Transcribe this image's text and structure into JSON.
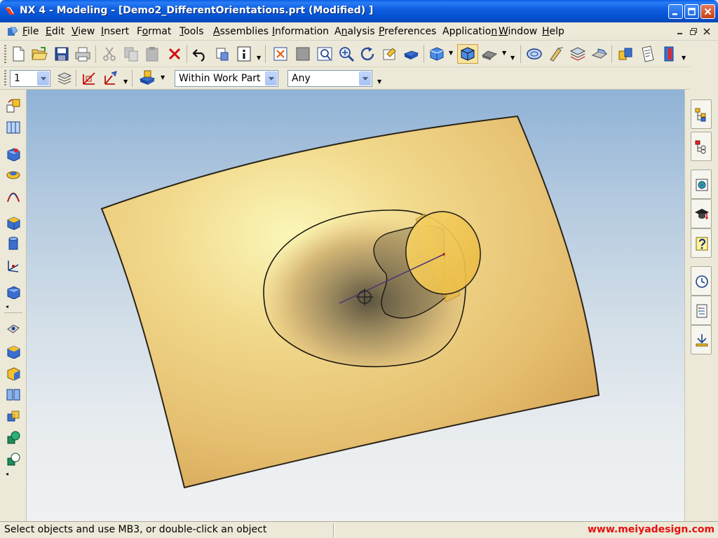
{
  "window": {
    "title": "NX 4 - Modeling - [Demo2_DifferentOrientations.prt (Modified) ]"
  },
  "menu": {
    "items": [
      {
        "pre": "",
        "mn": "F",
        "post": "ile"
      },
      {
        "pre": "",
        "mn": "E",
        "post": "dit"
      },
      {
        "pre": "",
        "mn": "V",
        "post": "iew"
      },
      {
        "pre": "",
        "mn": "I",
        "post": "nsert"
      },
      {
        "pre": "F",
        "mn": "o",
        "post": "rmat"
      },
      {
        "pre": "",
        "mn": "T",
        "post": "ools"
      },
      {
        "pre": "",
        "mn": "A",
        "post": "ssemblies"
      },
      {
        "pre": "",
        "mn": "I",
        "post": "nformation"
      },
      {
        "pre": "A",
        "mn": "n",
        "post": "alysis"
      },
      {
        "pre": "",
        "mn": "P",
        "post": "references"
      },
      {
        "pre": "Applicatio",
        "mn": "n",
        "post": ""
      },
      {
        "pre": "",
        "mn": "W",
        "post": "indow"
      },
      {
        "pre": "",
        "mn": "H",
        "post": "elp"
      }
    ]
  },
  "toolbar2": {
    "layer_value": "1",
    "filter_scope": "Within Work Part",
    "type_filter": "Any"
  },
  "status": {
    "prompt": "Select objects and use MB3, or double-click an object",
    "watermark": "www.meiyadesign.com"
  },
  "colors": {
    "title_bar": "#0054e3",
    "surface": "#e7c27c",
    "watermark": "#e81010"
  },
  "icons": {
    "toolbar1": [
      "new-icon",
      "open-icon",
      "save-icon",
      "print-icon",
      "cut-icon",
      "copy-icon",
      "paste-icon",
      "delete-icon",
      "undo-icon",
      "repeat-command-icon",
      "information-icon",
      "fit-icon",
      "zoom-window-icon",
      "zoom-box-icon",
      "zoom-icon",
      "rotate-icon",
      "pan-icon",
      "refresh-icon",
      "shaded-view-icon",
      "shaded-edges-icon",
      "wireframe-icon",
      "render-style-icon",
      "face-analysis-icon",
      "measure-icon",
      "layer-settings-icon",
      "section-icon",
      "assembly-icon",
      "notes-icon",
      "exit-icon"
    ],
    "leftbar": [
      "sketch-icon",
      "datum-plane-icon",
      "extrude-icon",
      "revolve-icon",
      "swept-icon",
      "block-icon",
      "cylinder-icon",
      "datum-csys-icon",
      "cube-icon",
      "face-blend-icon",
      "edge-blend-icon",
      "chamfer-icon",
      "book-icon",
      "offset-icon",
      "unite-icon",
      "subtract-icon"
    ],
    "rightbar": [
      "assembly-navigator-icon",
      "part-navigator-icon",
      "web-browser-icon",
      "training-icon",
      "help-icon",
      "history-icon",
      "reuse-library-icon",
      "roles-icon"
    ]
  }
}
